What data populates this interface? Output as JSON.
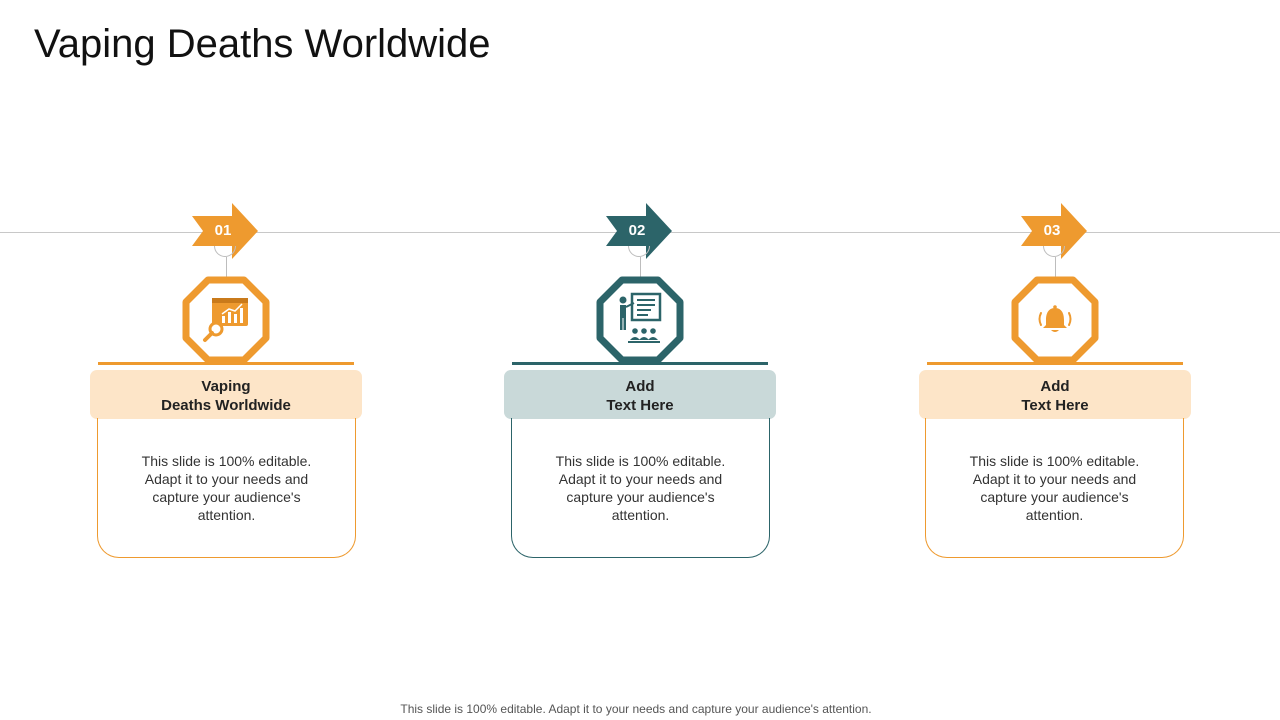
{
  "title": "Vaping Deaths Worldwide",
  "colors": {
    "orange": "#EE9A2F",
    "teal": "#2C6469",
    "orange_tint": "#FDE5C8",
    "teal_tint": "#C9D9D9"
  },
  "steps": [
    {
      "number": "01",
      "icon": "analytics-search-icon",
      "heading_line1": "Vaping",
      "heading_line2": "Deaths Worldwide",
      "body": "This slide is 100% editable. Adapt it to your needs and capture your audience's attention."
    },
    {
      "number": "02",
      "icon": "presentation-audience-icon",
      "heading_line1": "Add",
      "heading_line2": "Text Here",
      "body": "This slide is 100% editable. Adapt it to your needs and capture your audience's attention."
    },
    {
      "number": "03",
      "icon": "bell-ringing-icon",
      "heading_line1": "Add",
      "heading_line2": "Text Here",
      "body": "This slide is 100% editable. Adapt it to your needs and capture your audience's attention."
    }
  ],
  "footer": "This slide is 100% editable. Adapt it to your needs and capture your audience's attention."
}
